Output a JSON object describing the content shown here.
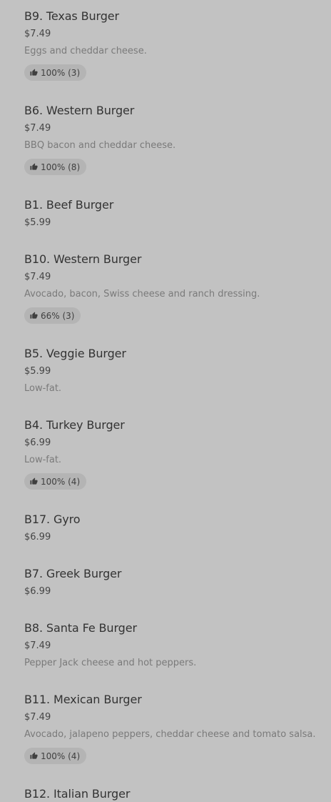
{
  "menu": {
    "items": [
      {
        "name": "B9. Texas Burger",
        "price": "$7.49",
        "description": "Eggs and cheddar cheese.",
        "rating": "100% (3)"
      },
      {
        "name": "B6. Western Burger",
        "price": "$7.49",
        "description": "BBQ bacon and cheddar cheese.",
        "rating": "100% (8)"
      },
      {
        "name": "B1. Beef Burger",
        "price": "$5.99"
      },
      {
        "name": "B10. Western Burger",
        "price": "$7.49",
        "description": "Avocado, bacon, Swiss cheese and ranch dressing.",
        "rating": "66% (3)"
      },
      {
        "name": "B5. Veggie Burger",
        "price": "$5.99",
        "description": "Low-fat."
      },
      {
        "name": "B4. Turkey Burger",
        "price": "$6.99",
        "description": "Low-fat.",
        "rating": "100% (4)"
      },
      {
        "name": "B17. Gyro",
        "price": "$6.99"
      },
      {
        "name": "B7. Greek Burger",
        "price": "$6.99"
      },
      {
        "name": "B8. Santa Fe Burger",
        "price": "$7.49",
        "description": "Pepper Jack cheese and hot peppers."
      },
      {
        "name": "B11. Mexican Burger",
        "price": "$7.49",
        "description": "Avocado, jalapeno peppers, cheddar cheese and tomato salsa.",
        "rating": "100% (4)"
      },
      {
        "name": "B12. Italian Burger"
      }
    ]
  },
  "icons": {
    "rating": "thumbs-up-icon"
  }
}
